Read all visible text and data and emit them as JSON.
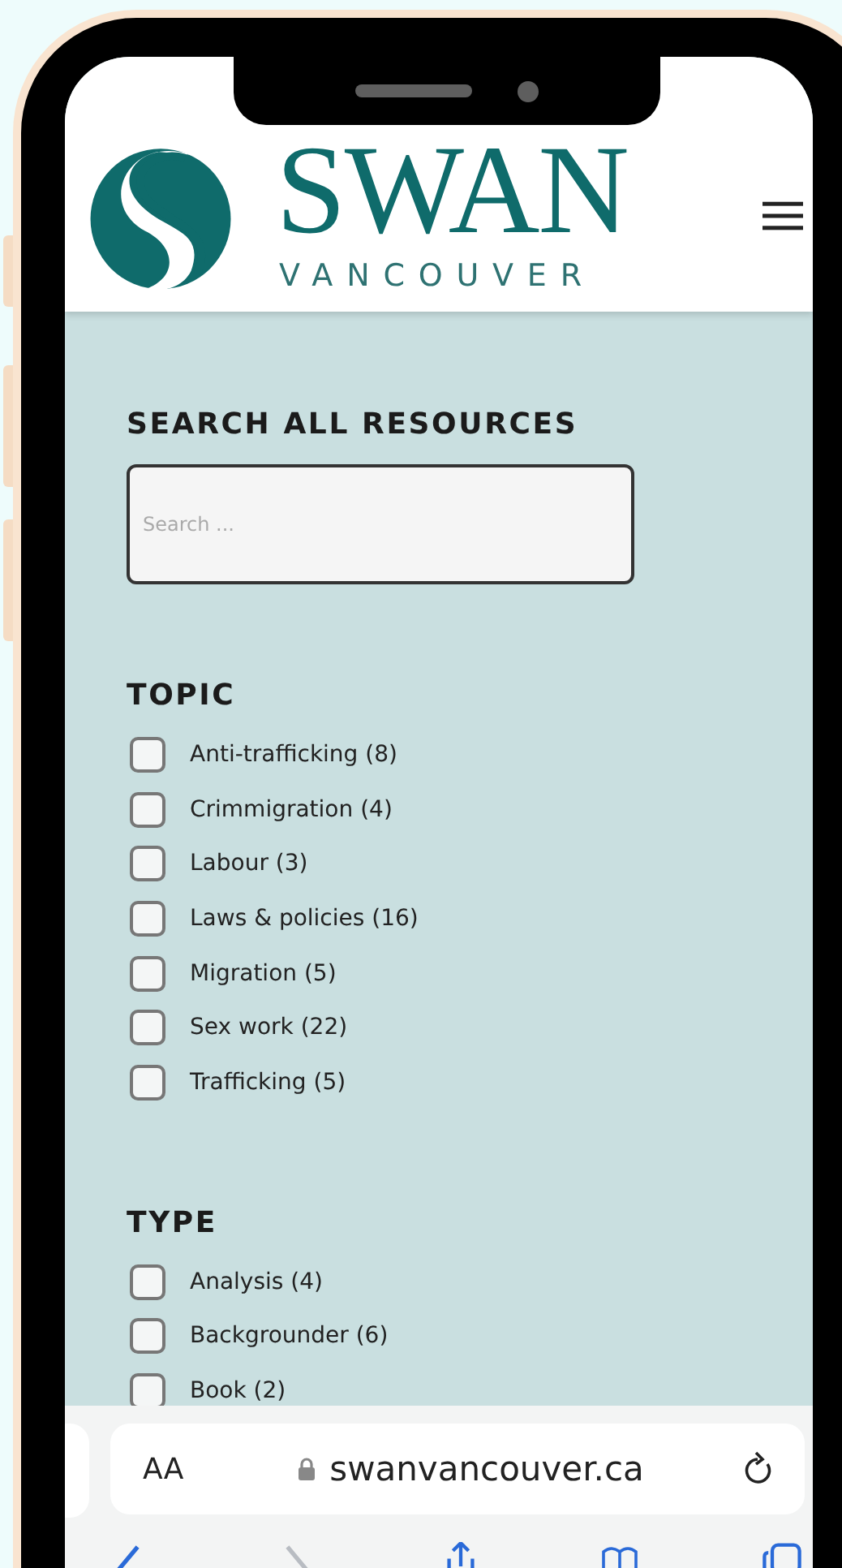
{
  "header": {
    "logo_name": "SWAN",
    "logo_place": "VANCOUVER"
  },
  "search": {
    "title": "SEARCH ALL RESOURCES",
    "placeholder": "Search ..."
  },
  "sections": [
    {
      "title": "TOPIC",
      "items": [
        {
          "label": "Anti-trafficking (8)",
          "checked": false
        },
        {
          "label": "Crimmigration (4)",
          "checked": false
        },
        {
          "label": "Labour (3)",
          "checked": false
        },
        {
          "label": "Laws & policies (16)",
          "checked": false
        },
        {
          "label": "Migration (5)",
          "checked": false
        },
        {
          "label": "Sex work (22)",
          "checked": false
        },
        {
          "label": "Trafficking (5)",
          "checked": false
        }
      ]
    },
    {
      "title": "TYPE",
      "items": [
        {
          "label": "Analysis (4)",
          "checked": false
        },
        {
          "label": "Backgrounder (6)",
          "checked": false
        },
        {
          "label": "Book (2)",
          "checked": false
        }
      ]
    }
  ],
  "browser": {
    "text_size": "AA",
    "url": "swanvancouver.ca"
  }
}
